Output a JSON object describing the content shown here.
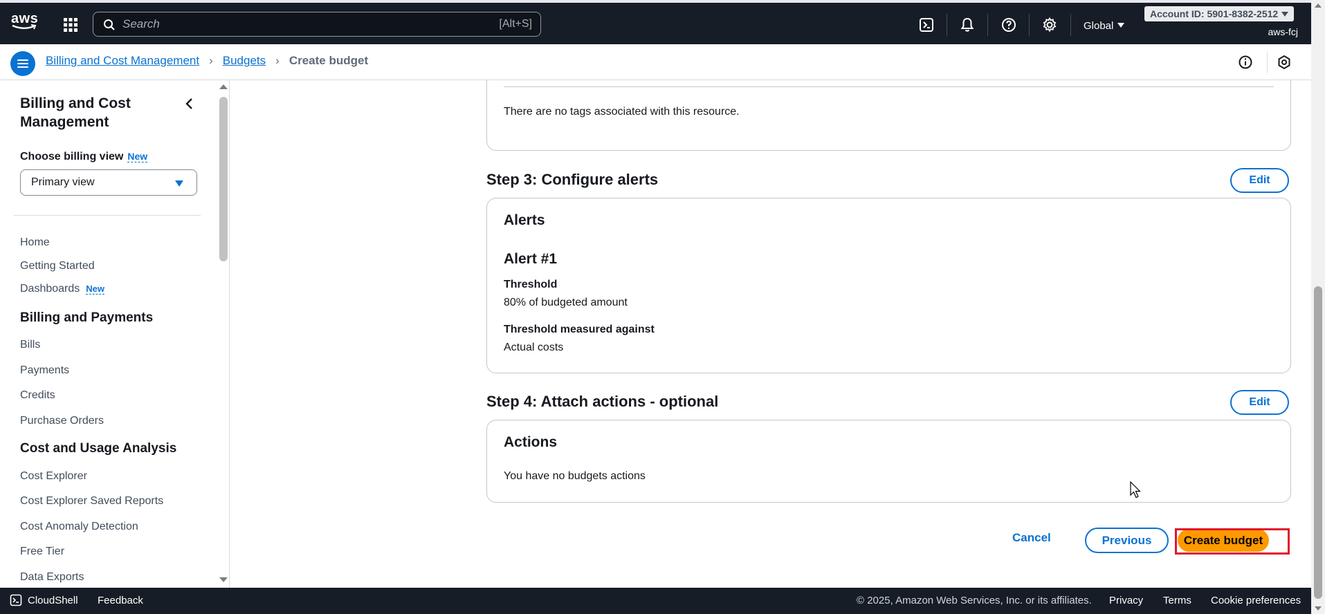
{
  "topnav": {
    "logo_text": "aws",
    "search_placeholder": "Search",
    "search_shortcut": "[Alt+S]",
    "region": "Global",
    "account_id": "Account ID: 5901-8382-2512",
    "username": "aws-fcj",
    "icons": [
      "cloudshell-icon",
      "bell-icon",
      "help-icon",
      "gear-icon"
    ]
  },
  "breadcrumb": {
    "items": [
      "Billing and Cost Management",
      "Budgets"
    ],
    "current": "Create budget"
  },
  "sidebar": {
    "title": "Billing and Cost Management",
    "billing_view_label": "Choose billing view",
    "billing_view_badge": "New",
    "billing_view_value": "Primary view",
    "items": [
      {
        "label": "Home"
      },
      {
        "label": "Getting Started"
      },
      {
        "label": "Dashboards",
        "badge": "New"
      }
    ],
    "section1": "Billing and Payments",
    "section1_items": [
      "Bills",
      "Payments",
      "Credits",
      "Purchase Orders"
    ],
    "section2": "Cost and Usage Analysis",
    "section2_items": [
      "Cost Explorer",
      "Cost Explorer Saved Reports",
      "Cost Anomaly Detection",
      "Free Tier",
      "Data Exports"
    ]
  },
  "main": {
    "tags_text": "There are no tags associated with this resource.",
    "step3": {
      "title": "Step 3: Configure alerts",
      "edit": "Edit",
      "heading": "Alerts",
      "alert_title": "Alert #1",
      "threshold_label": "Threshold",
      "threshold_value": "80% of budgeted amount",
      "measured_label": "Threshold measured against",
      "measured_value": "Actual costs"
    },
    "step4": {
      "title": "Step 4: Attach actions - optional",
      "edit": "Edit",
      "heading": "Actions",
      "text": "You have no budgets actions"
    },
    "buttons": {
      "cancel": "Cancel",
      "previous": "Previous",
      "create": "Create budget"
    }
  },
  "footer": {
    "cloudshell": "CloudShell",
    "feedback": "Feedback",
    "copyright": "© 2025, Amazon Web Services, Inc. or its affiliates.",
    "privacy": "Privacy",
    "terms": "Terms",
    "cookies": "Cookie preferences"
  },
  "colors": {
    "nav_bg": "#161d26",
    "link": "#0972d3",
    "primary_button": "#ff9900",
    "highlight_box": "#e0162b"
  }
}
